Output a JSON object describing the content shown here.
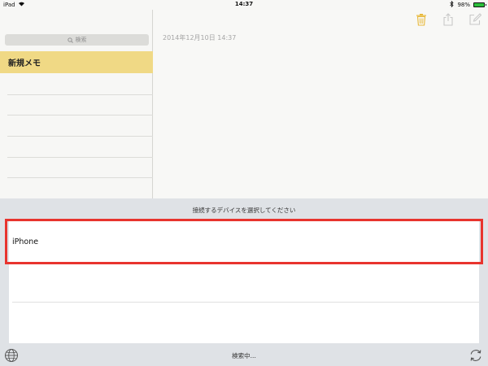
{
  "status_bar": {
    "device": "iPad",
    "time": "14:37",
    "battery_percent": "98%",
    "battery_level": 0.98
  },
  "sidebar": {
    "search_placeholder": "検索",
    "notes": [
      {
        "title": "新規メモ"
      }
    ]
  },
  "note": {
    "date": "2014年12月10日 14:37"
  },
  "toolbar": {
    "icons": [
      "trash-icon",
      "share-icon",
      "compose-icon"
    ],
    "accent_color": "#e8b93a"
  },
  "device_picker": {
    "title": "接続するデバイスを選択してください",
    "devices": [
      {
        "name": "iPhone",
        "highlighted": true
      }
    ],
    "status": "検索中...",
    "highlight_color": "#e8342e"
  }
}
